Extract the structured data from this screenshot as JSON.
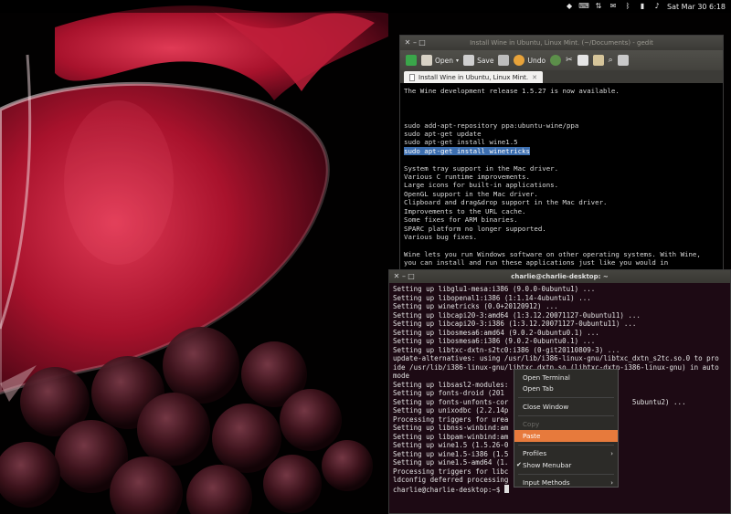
{
  "top_panel": {
    "icons": [
      "dropbox-icon",
      "keyboard-icon",
      "network-icon",
      "mail-icon",
      "bluetooth-icon",
      "battery-icon",
      "volume-icon"
    ],
    "clock": "Sat Mar 30  6:18"
  },
  "gedit": {
    "title": "Install Wine in Ubuntu, Linux Mint. (~/Documents) - gedit",
    "toolbar": {
      "open": "Open",
      "save": "Save",
      "undo": "Undo"
    },
    "tab_label": "Install Wine in Ubuntu, Linux Mint.",
    "lines": [
      "The Wine development release 1.5.27 is now available.",
      "",
      "",
      "",
      "sudo add-apt-repository ppa:ubuntu-wine/ppa",
      "sudo apt-get update",
      "sudo apt-get install wine1.5",
      "sudo apt-get install winetricks",
      "",
      "System tray support in the Mac driver.",
      "Various C runtime improvements.",
      "Large icons for built-in applications.",
      "OpenGL support in the Mac driver.",
      "Clipboard and drag&drop support in the Mac driver.",
      "Improvements to the URL cache.",
      "Some fixes for ARM binaries.",
      "SPARC platform no longer supported.",
      "Various bug fixes.",
      "",
      "Wine lets you run Windows software on other operating systems. With Wine,",
      "you can install and run these applications just like you would in"
    ],
    "highlighted_line": "sudo apt-get install winetricks"
  },
  "terminal": {
    "title": "charlie@charlie-desktop: ~",
    "lines": [
      "Setting up libglu1-mesa:i386 (9.0.0-0ubuntu1) ...",
      "Setting up libopenal1:i386 (1:1.14-4ubuntu1) ...",
      "Setting up winetricks (0.0+20120912) ...",
      "Setting up libcapi20-3:amd64 (1:3.12.20071127-0ubuntu11) ...",
      "Setting up libcapi20-3:i386 (1:3.12.20071127-0ubuntu11) ...",
      "Setting up libosmesa6:amd64 (9.0.2-0ubuntu0.1) ...",
      "Setting up libosmesa6:i386 (9.0.2-0ubuntu0.1) ...",
      "Setting up libtxc-dxtn-s2tc0:i386 (0-git20110809-3) ...",
      "update-alternatives: using /usr/lib/i386-linux-gnu/libtxc_dxtn_s2tc.so.0 to pro",
      "ide /usr/lib/i386-linux-gnu/libtxc_dxtn.so (libtxc-dxtn-i386-linux-gnu) in auto",
      "mode",
      "Setting up libsasl2-modules:",
      "Setting up fonts-droid (201",
      "Setting up fonts-unfonts-cor                              5ubuntu2) ...",
      "Setting up unixodbc (2.2.14p",
      "Processing triggers for urea",
      "Setting up libnss-winbind:am",
      "Setting up libpam-winbind:am",
      "Setting up wine1.5 (1.5.26-0",
      "Setting up wine1.5-i386 (1.5",
      "Setting up wine1.5-amd64 (1.",
      "Processing triggers for libc",
      "ldconfig deferred processing",
      "charlie@charlie-desktop:~$ "
    ]
  },
  "context_menu": {
    "items": [
      {
        "label": "Open Terminal",
        "state": "normal"
      },
      {
        "label": "Open Tab",
        "state": "normal"
      },
      {
        "label": "Close Window",
        "state": "normal"
      },
      {
        "label": "Copy",
        "state": "disabled"
      },
      {
        "label": "Paste",
        "state": "hover"
      },
      {
        "label": "Profiles",
        "state": "submenu"
      },
      {
        "label": "Show Menubar",
        "state": "checked"
      },
      {
        "label": "Input Methods",
        "state": "submenu"
      }
    ]
  }
}
